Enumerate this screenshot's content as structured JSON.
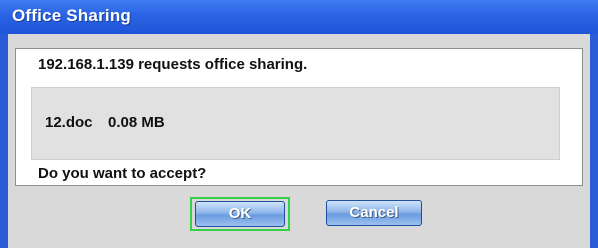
{
  "window": {
    "title": "Office Sharing"
  },
  "dialog": {
    "request_message": "192.168.1.139 requests office sharing.",
    "file": {
      "name": "12.doc",
      "size": "0.08 MB"
    },
    "question": "Do you want to accept?"
  },
  "buttons": {
    "ok_label": "OK",
    "cancel_label": "Cancel"
  },
  "colors": {
    "titlebar": "#2a63e4",
    "focus_ring": "#35d047",
    "button_face": "#8fb6ea"
  }
}
